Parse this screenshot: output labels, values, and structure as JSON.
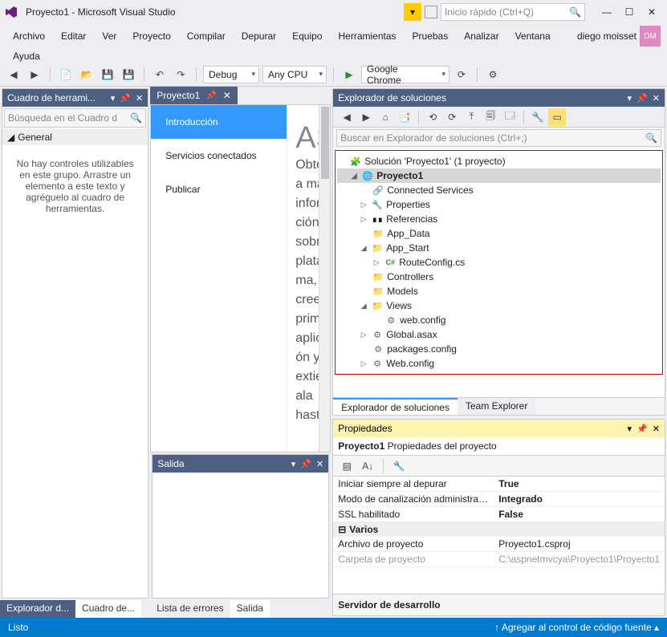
{
  "title": "Proyecto1 - Microsoft Visual Studio",
  "quick_launch_placeholder": "Inicio rápido (Ctrl+Q)",
  "user": {
    "name": "diego moisset",
    "initials": "DM"
  },
  "menu": [
    "Archivo",
    "Editar",
    "Ver",
    "Proyecto",
    "Compilar",
    "Depurar",
    "Equipo",
    "Herramientas",
    "Pruebas",
    "Analizar",
    "Ventana",
    "Ayuda"
  ],
  "toolbar": {
    "config": "Debug",
    "platform": "Any CPU",
    "run_target": "Google Chrome"
  },
  "toolbox": {
    "title": "Cuadro de herrami...",
    "search_placeholder": "Búsqueda en el Cuadro d",
    "group": "General",
    "empty_text": "No hay controles utilizables en este grupo. Arrastre un elemento a este texto y agréguelo al cuadro de herramientas."
  },
  "left_bottom_tabs": {
    "a": "Explorador d...",
    "b": "Cuadro de..."
  },
  "doc": {
    "tab": "Proyecto1",
    "nav": {
      "intro": "Introducción",
      "services": "Servicios conectados",
      "publish": "Publicar"
    },
    "heading": "ASP",
    "body": "Obtenga más información sobre la plataforma, cree su primera aplicación y extiéndala hasta la"
  },
  "output": {
    "title": "Salida"
  },
  "center_bottom_tabs": {
    "a": "Lista de errores",
    "b": "Salida"
  },
  "solution_explorer": {
    "title": "Explorador de soluciones",
    "search_placeholder": "Buscar en Explorador de soluciones (Ctrl+;)",
    "root": "Solución 'Proyecto1'  (1 proyecto)",
    "project": "Proyecto1",
    "nodes": {
      "connected": "Connected Services",
      "properties": "Properties",
      "references": "Referencias",
      "app_data": "App_Data",
      "app_start": "App_Start",
      "routeconfig": "RouteConfig.cs",
      "controllers": "Controllers",
      "models": "Models",
      "views": "Views",
      "web_config_views": "web.config",
      "global_asax": "Global.asax",
      "packages_config": "packages.config",
      "web_config": "Web.config"
    },
    "tabs": {
      "a": "Explorador de soluciones",
      "b": "Team Explorer"
    }
  },
  "properties": {
    "title": "Propiedades",
    "subtitle_bold": "Proyecto1",
    "subtitle_rest": " Propiedades del proyecto",
    "rows": {
      "r1k": "Iniciar siempre al depurar",
      "r1v": "True",
      "r2k": "Modo de canalización administrado",
      "r2v": "Integrado",
      "r3k": "SSL habilitado",
      "r3v": "False",
      "cat": "Varios",
      "r4k": "Archivo de proyecto",
      "r4v": "Proyecto1.csproj",
      "r5k": "Carpeta de proyecto",
      "r5v": "C:\\aspnetmvcya\\Proyecto1\\Proyecto1"
    },
    "desc": "Servidor de desarrollo"
  },
  "status": {
    "ready": "Listo",
    "source_control": "Agregar al control de código fuente"
  }
}
